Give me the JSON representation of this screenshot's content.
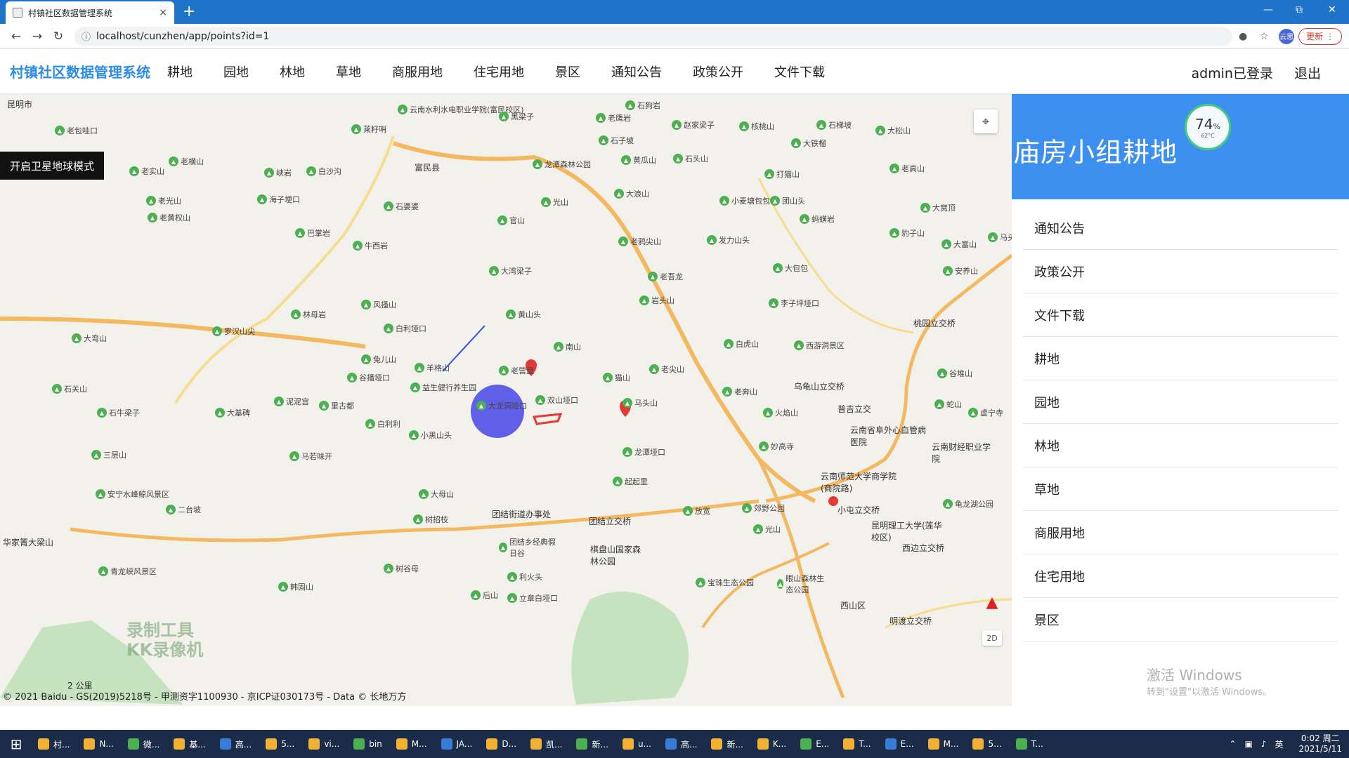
{
  "browser": {
    "tab_title": "村镇社区数据管理系统",
    "tab_close": "×",
    "new_tab": "+",
    "url": "localhost/cunzhen/app/points?id=1",
    "profile": "云思",
    "update_label": "更新"
  },
  "header": {
    "brand": "村镇社区数据管理系统",
    "nav": [
      "耕地",
      "园地",
      "林地",
      "草地",
      "商服用地",
      "住宅用地",
      "景区",
      "通知公告",
      "政策公开",
      "文件下载"
    ],
    "user_status": "admin已登录",
    "logout": "退出"
  },
  "map": {
    "satellite_button": "开启卫星地球模式",
    "region_label": "昆明市",
    "mode_label": "2D",
    "scale": "2 公里",
    "copyright": "© 2021 Baidu - GS(2019)5218号 - 甲测资字1100930 - 京ICP证030173号 - Data © 长地万方",
    "watermark": [
      "录制工具",
      "KK录像机"
    ],
    "places": [
      {
        "name": "云南水利水电职业学院(富民校区)"
      },
      {
        "name": "黑梁子"
      },
      {
        "name": "石狗岩"
      },
      {
        "name": "老鹰岩"
      },
      {
        "name": "赵家梁子"
      },
      {
        "name": "核桃山"
      },
      {
        "name": "石梯坡"
      },
      {
        "name": "大松山"
      },
      {
        "name": "老包哇口"
      },
      {
        "name": "莱籽哨"
      },
      {
        "name": "石子坡"
      },
      {
        "name": "大铁榴"
      },
      {
        "name": "富民县"
      },
      {
        "name": "老实山"
      },
      {
        "name": "老横山"
      },
      {
        "name": "龙潭森林公园"
      },
      {
        "name": "黄瓜山"
      },
      {
        "name": "石头山"
      },
      {
        "name": "老高山"
      },
      {
        "name": "老光山"
      },
      {
        "name": "峡岩"
      },
      {
        "name": "白沙沟"
      },
      {
        "name": "海子埂口"
      },
      {
        "name": "打猫山"
      },
      {
        "name": "老黄权山"
      },
      {
        "name": "石婆婆"
      },
      {
        "name": "光山"
      },
      {
        "name": "大浪山"
      },
      {
        "name": "小麦塘包包"
      },
      {
        "name": "团山头"
      },
      {
        "name": "大窝顶"
      },
      {
        "name": "官山"
      },
      {
        "name": "蚂蟥岩"
      },
      {
        "name": "巴掌岩"
      },
      {
        "name": "老鸦尖山"
      },
      {
        "name": "发力山头"
      },
      {
        "name": "豹子山"
      },
      {
        "name": "大富山"
      },
      {
        "name": "马头山"
      },
      {
        "name": "牛西岩"
      },
      {
        "name": "大湾梁子"
      },
      {
        "name": "大包包"
      },
      {
        "name": "安养山"
      },
      {
        "name": "老吾龙"
      },
      {
        "name": "岩头山"
      },
      {
        "name": "李子坪垭口"
      },
      {
        "name": "风搔山"
      },
      {
        "name": "黄山头"
      },
      {
        "name": "林母岩"
      },
      {
        "name": "罗汉山尖"
      },
      {
        "name": "白利垭口"
      },
      {
        "name": "大弯山"
      },
      {
        "name": "南山"
      },
      {
        "name": "白虎山"
      },
      {
        "name": "桃园立交桥"
      },
      {
        "name": "西游洞景区"
      },
      {
        "name": "兔儿山"
      },
      {
        "name": "羊格山"
      },
      {
        "name": "老营盘"
      },
      {
        "name": "谷播垭口"
      },
      {
        "name": "猫山"
      },
      {
        "name": "老尖山"
      },
      {
        "name": "谷堆山"
      },
      {
        "name": "石关山"
      },
      {
        "name": "益生健行养生园"
      },
      {
        "name": "老奔山"
      },
      {
        "name": "乌龟山立交桥"
      },
      {
        "name": "马头山"
      },
      {
        "name": "石牛梁子"
      },
      {
        "name": "大基碑"
      },
      {
        "name": "泥泥宫"
      },
      {
        "name": "里古都"
      },
      {
        "name": "大龙洞垭口"
      },
      {
        "name": "双山垭口"
      },
      {
        "name": "火焰山"
      },
      {
        "name": "普吉立交"
      },
      {
        "name": "蛇山"
      },
      {
        "name": "虚宁寺"
      },
      {
        "name": "白利利"
      },
      {
        "name": "小黑山头"
      },
      {
        "name": "云南省阜外心血管病医院"
      },
      {
        "name": "三层山"
      },
      {
        "name": "马若味开"
      },
      {
        "name": "龙潭垭口"
      },
      {
        "name": "妙高寺"
      },
      {
        "name": "云南财经职业学院"
      },
      {
        "name": "起起里"
      },
      {
        "name": "云南师范大学商学院(商院路)"
      },
      {
        "name": "安宁水峰鲸风景区"
      },
      {
        "name": "大母山"
      },
      {
        "name": "二台坡"
      },
      {
        "name": "团结街道办事处"
      },
      {
        "name": "小屯立交桥"
      },
      {
        "name": "龟龙湖公园"
      },
      {
        "name": "郊野公园"
      },
      {
        "name": "树招枝"
      },
      {
        "name": "团结立交桥"
      },
      {
        "name": "放宽"
      },
      {
        "name": "光山"
      },
      {
        "name": "昆明理工大学(莲华校区)"
      },
      {
        "name": "团结乡经典假日谷"
      },
      {
        "name": "棋盘山国家森林公园"
      },
      {
        "name": "华家箐大梁山"
      },
      {
        "name": "青龙峡风景区"
      },
      {
        "name": "树谷母"
      },
      {
        "name": "西边立交桥"
      },
      {
        "name": "利火头"
      },
      {
        "name": "宝珠生态公园"
      },
      {
        "name": "眼山森林生态公园"
      },
      {
        "name": "韩固山"
      },
      {
        "name": "后山"
      },
      {
        "name": "立章白垭口"
      },
      {
        "name": "明渡立交桥"
      },
      {
        "name": "西山区"
      }
    ]
  },
  "panel": {
    "title": "庙房小组耕地",
    "gauge_percent": "74",
    "gauge_unit": "%",
    "gauge_temp": "62°C",
    "gauge_value": 0.74,
    "menu": [
      "通知公告",
      "政策公开",
      "文件下载",
      "耕地",
      "园地",
      "林地",
      "草地",
      "商服用地",
      "住宅用地",
      "景区"
    ],
    "activation_title": "激活 Windows",
    "activation_sub": "转到\"设置\"以激活 Windows。"
  },
  "taskbar": {
    "items": [
      "村...",
      "N...",
      "微...",
      "基...",
      "高...",
      "5...",
      "vi...",
      "bin",
      "M...",
      "JA...",
      "D...",
      "凯...",
      "新...",
      "u...",
      "高...",
      "新...",
      "K...",
      "E...",
      "T...",
      "E...",
      "M...",
      "5...",
      "T..."
    ],
    "ime": "英",
    "time": "0:02 周二",
    "date": "2021/5/11"
  },
  "colors": {
    "accent": "#3d8ff0",
    "brand": "#2f8de6",
    "browser_bar": "#1f73c9",
    "marker": "#e53935",
    "circle": "#3b3be6",
    "taskbar": "#1a2c48"
  }
}
